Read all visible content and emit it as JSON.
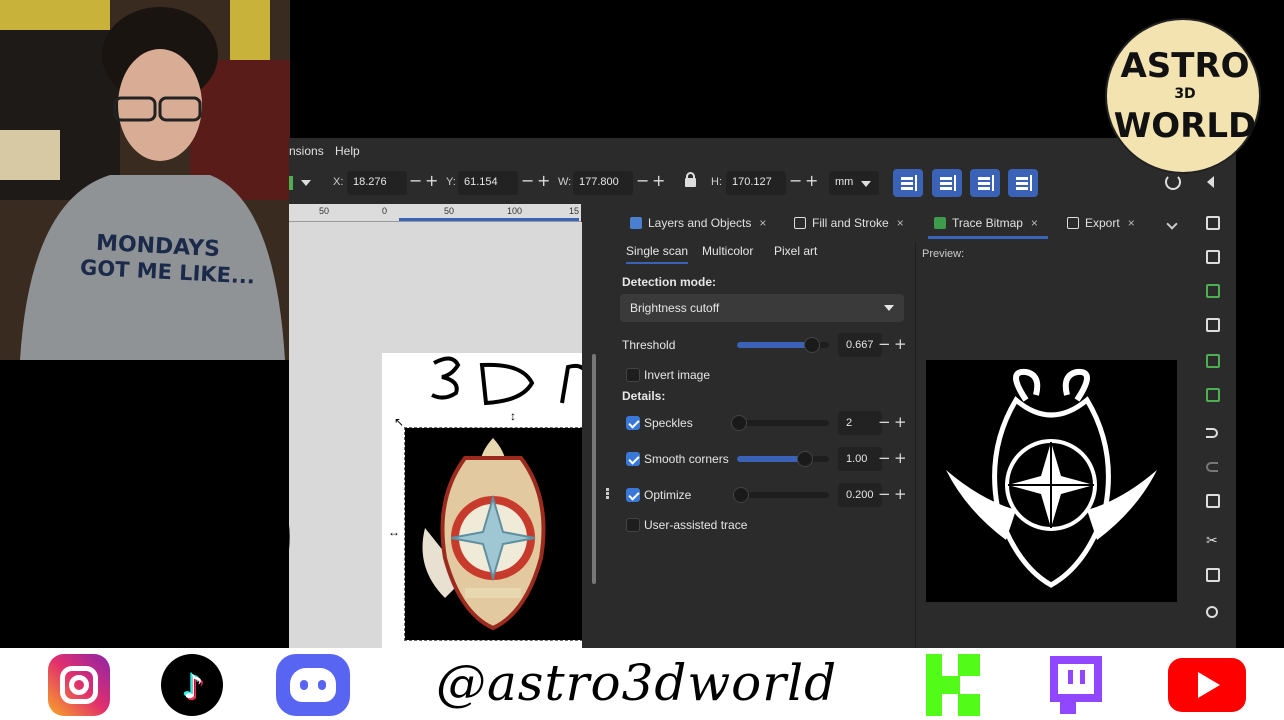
{
  "menu": {
    "extensions_partial": "nsions",
    "help": "Help"
  },
  "toolbar": {
    "x_label": "X:",
    "x_value": "18.276",
    "y_label": "Y:",
    "y_value": "61.154",
    "w_label": "W:",
    "w_value": "177.800",
    "h_label": "H:",
    "h_value": "170.127",
    "unit": "mm"
  },
  "ruler": {
    "ticks": [
      "50",
      "0",
      "50",
      "100",
      "15"
    ]
  },
  "dock": {
    "tabs": [
      {
        "label": "Layers and Objects",
        "close": "×"
      },
      {
        "label": "Fill and Stroke",
        "close": "×"
      },
      {
        "label": "Trace Bitmap",
        "close": "×"
      },
      {
        "label": "Export",
        "close": "×"
      }
    ],
    "active_tab": "Trace Bitmap"
  },
  "trace": {
    "modes": [
      "Single scan",
      "Multicolor",
      "Pixel art"
    ],
    "active_mode": "Single scan",
    "detection_mode_label": "Detection mode:",
    "detection_mode_value": "Brightness cutoff",
    "threshold_label": "Threshold",
    "threshold_value": "0.667",
    "threshold_fraction": 0.82,
    "invert_label": "Invert image",
    "invert_checked": false,
    "details_label": "Details:",
    "speckles_label": "Speckles",
    "speckles_value": "2",
    "speckles_fraction": 0.02,
    "smooth_label": "Smooth corners",
    "smooth_value": "1.00",
    "smooth_fraction": 0.74,
    "optimize_label": "Optimize",
    "optimize_value": "0.200",
    "optimize_fraction": 0.04,
    "user_assisted_label": "User-assisted trace",
    "minus": "−",
    "plus": "+",
    "preview_label": "Preview:"
  },
  "webcam": {
    "shirt_line1": "MONDAYS",
    "shirt_line2": "GOT ME LIKE..."
  },
  "logo": {
    "line1": "ASTRO",
    "line2": "3D",
    "line3": "WORLD"
  },
  "footer": {
    "handle": "@astro3dworld",
    "socials": [
      "instagram-icon",
      "tiktok-icon",
      "discord-icon",
      "kick-icon",
      "twitch-icon",
      "youtube-icon"
    ]
  },
  "colors": {
    "accent": "#3a63b8",
    "instagram": "#e1306c",
    "discord": "#5865f2",
    "kick": "#53fc18",
    "twitch": "#9146ff",
    "youtube": "#ff0000"
  }
}
